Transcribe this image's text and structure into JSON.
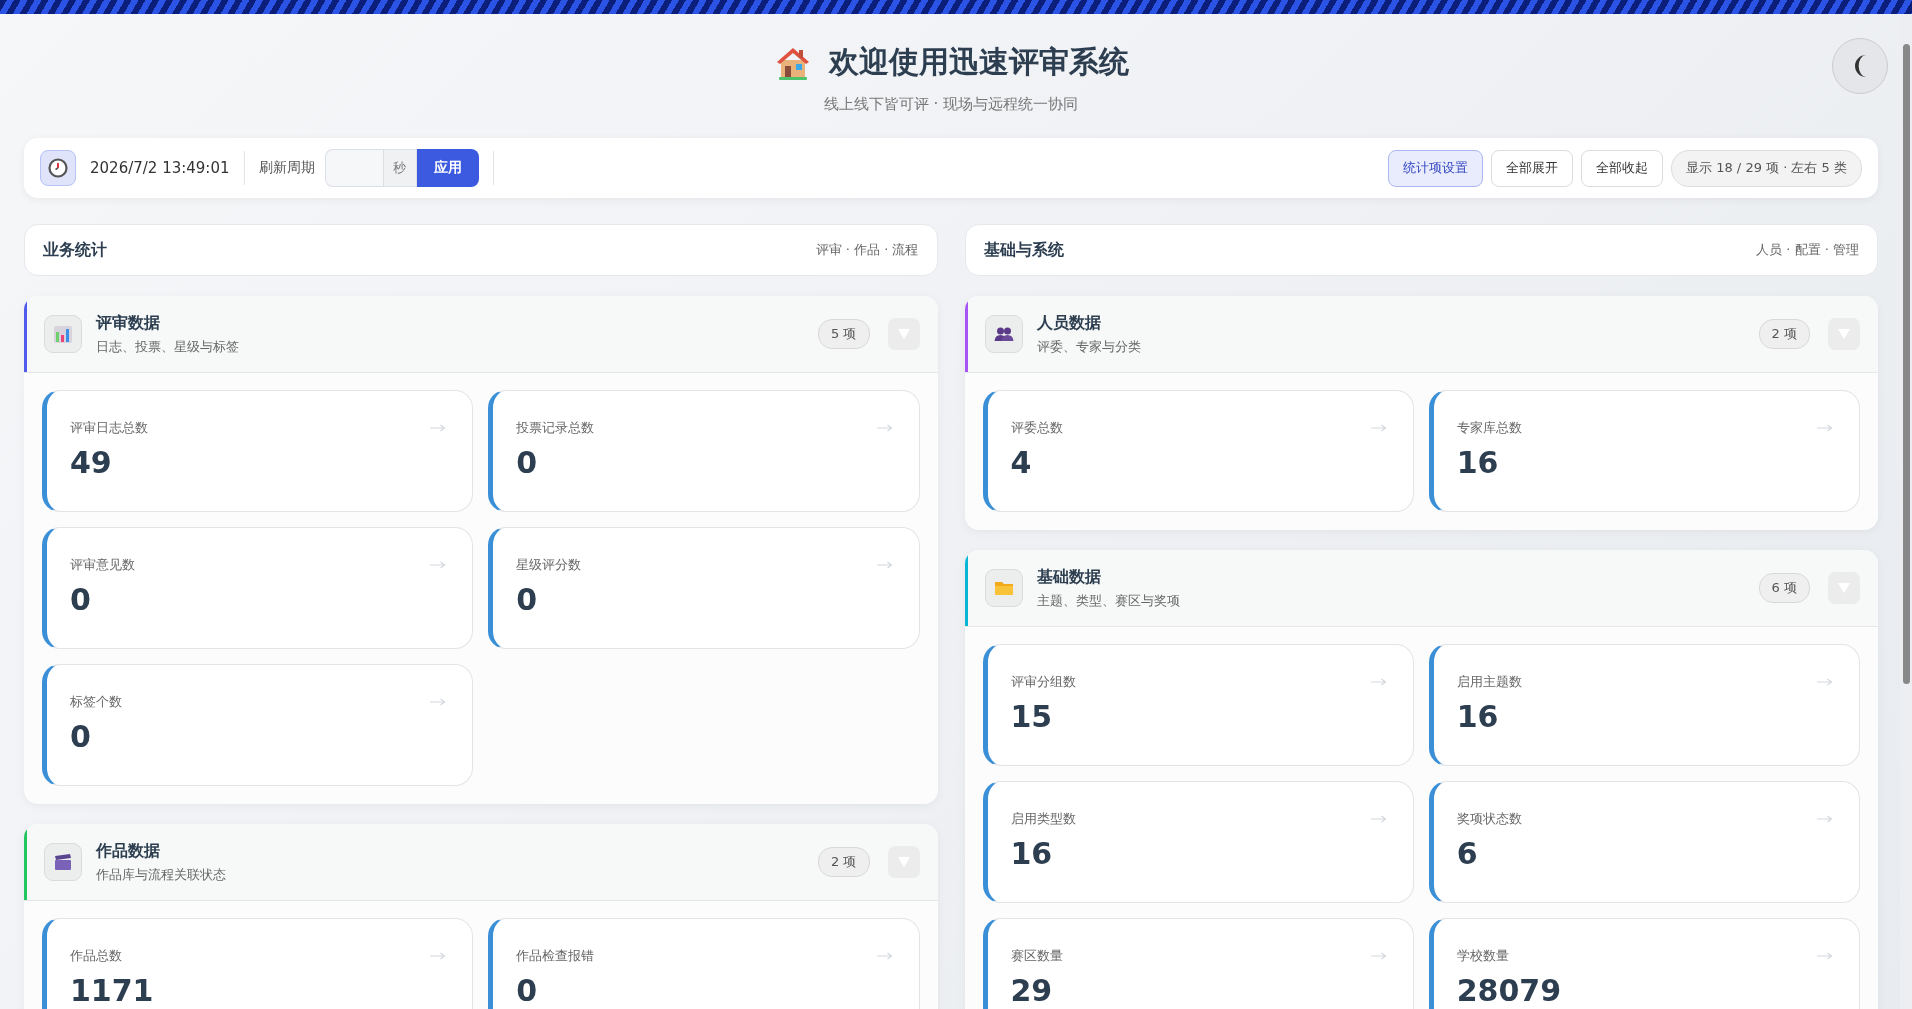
{
  "header": {
    "title": "欢迎使用迅速评审系统",
    "subtitle": "线上线下皆可评 · 现场与远程统一协同"
  },
  "toolbar": {
    "datetime": "2026/7/2 13:49:01",
    "refresh_label": "刷新周期",
    "refresh_unit": "秒",
    "apply_button": "应用",
    "buttons": [
      {
        "label": "统计项设置",
        "selected": true
      },
      {
        "label": "全部展开",
        "selected": false
      },
      {
        "label": "全部收起",
        "selected": false
      }
    ],
    "summary": "显示 18 / 29 项 · 左右 5 类"
  },
  "columns": [
    {
      "title": "业务统计",
      "hint": "评审 · 作品 · 流程",
      "groups": [
        {
          "title": "评审数据",
          "subtitle": "日志、投票、星级与标签",
          "count": "5 项",
          "color": "#4f5bea",
          "expanded": true,
          "stats": [
            {
              "label": "评审日志总数",
              "value": "49"
            },
            {
              "label": "投票记录总数",
              "value": "0"
            },
            {
              "label": "评审意见数",
              "value": "0"
            },
            {
              "label": "星级评分数",
              "value": "0"
            },
            {
              "label": "标签个数",
              "value": "0"
            }
          ]
        },
        {
          "title": "作品数据",
          "subtitle": "作品库与流程关联状态",
          "count": "2 项",
          "color": "#22c55e",
          "expanded": true,
          "stats": [
            {
              "label": "作品总数",
              "value": "1171"
            },
            {
              "label": "作品检查报错",
              "value": "0"
            }
          ]
        }
      ]
    },
    {
      "title": "基础与系统",
      "hint": "人员 · 配置 · 管理",
      "groups": [
        {
          "title": "人员数据",
          "subtitle": "评委、专家与分类",
          "count": "2 项",
          "color": "#a855f7",
          "expanded": true,
          "stats": [
            {
              "label": "评委总数",
              "value": "4"
            },
            {
              "label": "专家库总数",
              "value": "16"
            }
          ]
        },
        {
          "title": "基础数据",
          "subtitle": "主题、类型、赛区与奖项",
          "count": "6 项",
          "color": "#06b6d4",
          "expanded": true,
          "stats": [
            {
              "label": "评审分组数",
              "value": "15"
            },
            {
              "label": "启用主题数",
              "value": "16"
            },
            {
              "label": "启用类型数",
              "value": "16"
            },
            {
              "label": "奖项状态数",
              "value": "6"
            },
            {
              "label": "赛区数量",
              "value": "29"
            },
            {
              "label": "学校数量",
              "value": "28079"
            }
          ]
        }
      ]
    }
  ]
}
